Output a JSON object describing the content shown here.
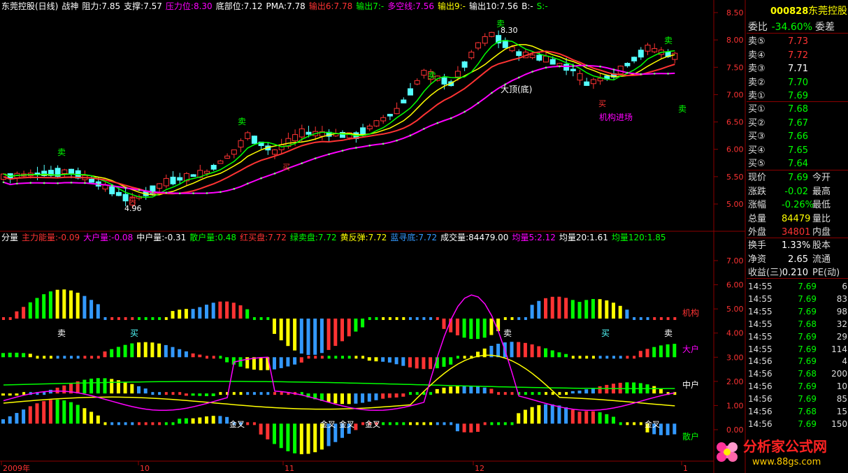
{
  "header_top": {
    "title": "东莞控股(日线)",
    "indicator": "战神",
    "items": [
      {
        "text": "阻力:7.85",
        "color": "#ffffff"
      },
      {
        "text": "支撑:7.57",
        "color": "#ffffff"
      },
      {
        "text": "压力位:8.30",
        "color": "#ff00ff"
      },
      {
        "text": "底部位:7.12",
        "color": "#ffffff"
      },
      {
        "text": "PMA:7.78",
        "color": "#ffffff"
      },
      {
        "text": "输出6:7.78",
        "color": "#ff3333"
      },
      {
        "text": "输出7:-",
        "color": "#00ff00"
      },
      {
        "text": "多空线:7.56",
        "color": "#ff00ff"
      },
      {
        "text": "输出9:-",
        "color": "#ffff00"
      },
      {
        "text": "输出10:7.56",
        "color": "#ffffff"
      },
      {
        "text": "B:-",
        "color": "#ffffff"
      },
      {
        "text": "S:-",
        "color": "#00ff00"
      }
    ]
  },
  "header_sub": {
    "title": "分量",
    "items": [
      {
        "text": "主力能量:-0.09",
        "color": "#ff3333"
      },
      {
        "text": "大户量:-0.08",
        "color": "#ff00ff"
      },
      {
        "text": "中户量:-0.31",
        "color": "#ffffff"
      },
      {
        "text": "散户量:0.48",
        "color": "#00ff00"
      },
      {
        "text": "红买盘:7.72",
        "color": "#ff3333"
      },
      {
        "text": "绿卖盘:7.72",
        "color": "#00ff00"
      },
      {
        "text": "黄反弹:7.72",
        "color": "#ffff00"
      },
      {
        "text": "蓝寻底:7.72",
        "color": "#3399ff"
      },
      {
        "text": "成交量:84479.00",
        "color": "#ffffff"
      },
      {
        "text": "均量5:2.12",
        "color": "#ff00ff"
      },
      {
        "text": "均量20:1.61",
        "color": "#ffffff"
      },
      {
        "text": "均量120:1.85",
        "color": "#00ff00"
      }
    ]
  },
  "main_axis": [
    "8.50",
    "8.00",
    "7.50",
    "7.00",
    "6.50",
    "6.00",
    "5.50",
    "5.00"
  ],
  "sub_axis": [
    "7.00",
    "6.00",
    "5.00",
    "4.00",
    "3.00",
    "2.00",
    "1.00",
    "0.00"
  ],
  "x_labels": [
    "2009年",
    "10",
    "11",
    "12",
    "1"
  ],
  "annotations": {
    "top_price": "8.30",
    "low_price": "4.96",
    "big_top": "大顶(底)",
    "inst_in": "机构进场",
    "sell": "卖",
    "buy": "买",
    "golden_cross": "金叉"
  },
  "sub_right_labels": {
    "inst": "机构",
    "big": "大户",
    "mid": "中户",
    "retail": "散户"
  },
  "quote": {
    "code": "000828",
    "name": "东莞控股",
    "weibi_label": "委比",
    "weibi_value": "-34.60%",
    "weicha_label": "委差",
    "asks": [
      {
        "label": "卖⑤",
        "price": "7.73"
      },
      {
        "label": "卖④",
        "price": "7.72"
      },
      {
        "label": "卖③",
        "price": "7.71"
      },
      {
        "label": "卖②",
        "price": "7.70"
      },
      {
        "label": "卖①",
        "price": "7.69"
      }
    ],
    "bids": [
      {
        "label": "买①",
        "price": "7.68"
      },
      {
        "label": "买②",
        "price": "7.67"
      },
      {
        "label": "买③",
        "price": "7.66"
      },
      {
        "label": "买④",
        "price": "7.65"
      },
      {
        "label": "买⑤",
        "price": "7.64"
      }
    ],
    "stats": [
      {
        "label": "现价",
        "value": "7.69",
        "label2": "今开"
      },
      {
        "label": "涨跌",
        "value": "-0.02",
        "label2": "最高"
      },
      {
        "label": "涨幅",
        "value": "-0.26%",
        "label2": "最低"
      },
      {
        "label": "总量",
        "value": "84479",
        "label2": "量比"
      },
      {
        "label": "外盘",
        "value": "34801",
        "label2": "内盘"
      }
    ],
    "stats2": [
      {
        "label": "换手",
        "value": "1.33%",
        "label2": "股本"
      },
      {
        "label": "净资",
        "value": "2.65",
        "label2": "流通"
      },
      {
        "label": "收益(三)",
        "value": "0.210",
        "label2": "PE(动)"
      }
    ],
    "ticks": [
      {
        "time": "14:55",
        "price": "7.69",
        "vol": "6"
      },
      {
        "time": "14:55",
        "price": "7.69",
        "vol": "83"
      },
      {
        "time": "14:55",
        "price": "7.69",
        "vol": "98"
      },
      {
        "time": "14:55",
        "price": "7.68",
        "vol": "32"
      },
      {
        "time": "14:55",
        "price": "7.69",
        "vol": "29"
      },
      {
        "time": "14:55",
        "price": "7.69",
        "vol": "114"
      },
      {
        "time": "14:56",
        "price": "7.69",
        "vol": "4"
      },
      {
        "time": "14:56",
        "price": "7.68",
        "vol": "200"
      },
      {
        "time": "14:56",
        "price": "7.69",
        "vol": "10"
      },
      {
        "time": "14:56",
        "price": "7.69",
        "vol": "85"
      },
      {
        "time": "14:56",
        "price": "7.68",
        "vol": "15"
      },
      {
        "time": "14:56",
        "price": "7.69",
        "vol": "150"
      }
    ]
  },
  "logo": {
    "text": "分析家公式网",
    "url": "www.88gs.com"
  },
  "colors": {
    "up": "#ff3333",
    "down": "#54ffff",
    "grid": "#8b0000",
    "white": "#ffffff",
    "yellow": "#ffff00",
    "green": "#00ff00",
    "magenta": "#ff00ff",
    "blue": "#3399ff"
  }
}
